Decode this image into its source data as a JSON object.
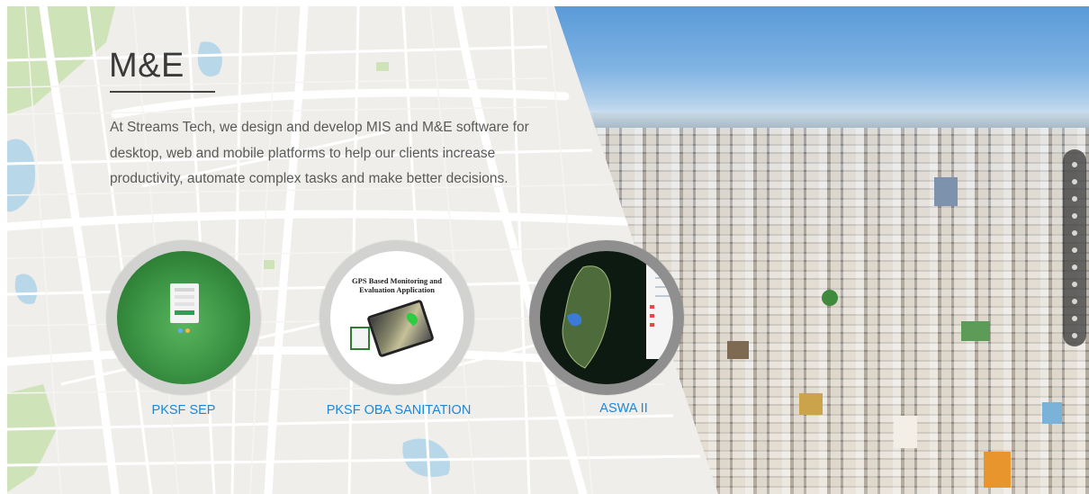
{
  "section": {
    "title": "M&E",
    "intro": "At Streams Tech, we design and develop MIS and M&E software for desktop, web and mobile platforms to help our clients increase productivity, automate complex tasks and make better decisions."
  },
  "projects": [
    {
      "label": "PKSF SEP",
      "thumb": "pksf-sep-screenshot"
    },
    {
      "label": "PKSF OBA SANITATION",
      "thumb": "gps-monitoring-app",
      "thumb_title": "GPS Based Monitoring and Evaluation Application"
    },
    {
      "label": "ASWA II",
      "thumb": "aswa-map-screenshot"
    }
  ],
  "colors": {
    "link": "#1d88d8",
    "title": "#3a3a3a",
    "text": "#5a5a5a",
    "ring": "#d2d3d1",
    "sep_green": "#2e7d32"
  },
  "scroll_indicator": {
    "dots": 11
  }
}
